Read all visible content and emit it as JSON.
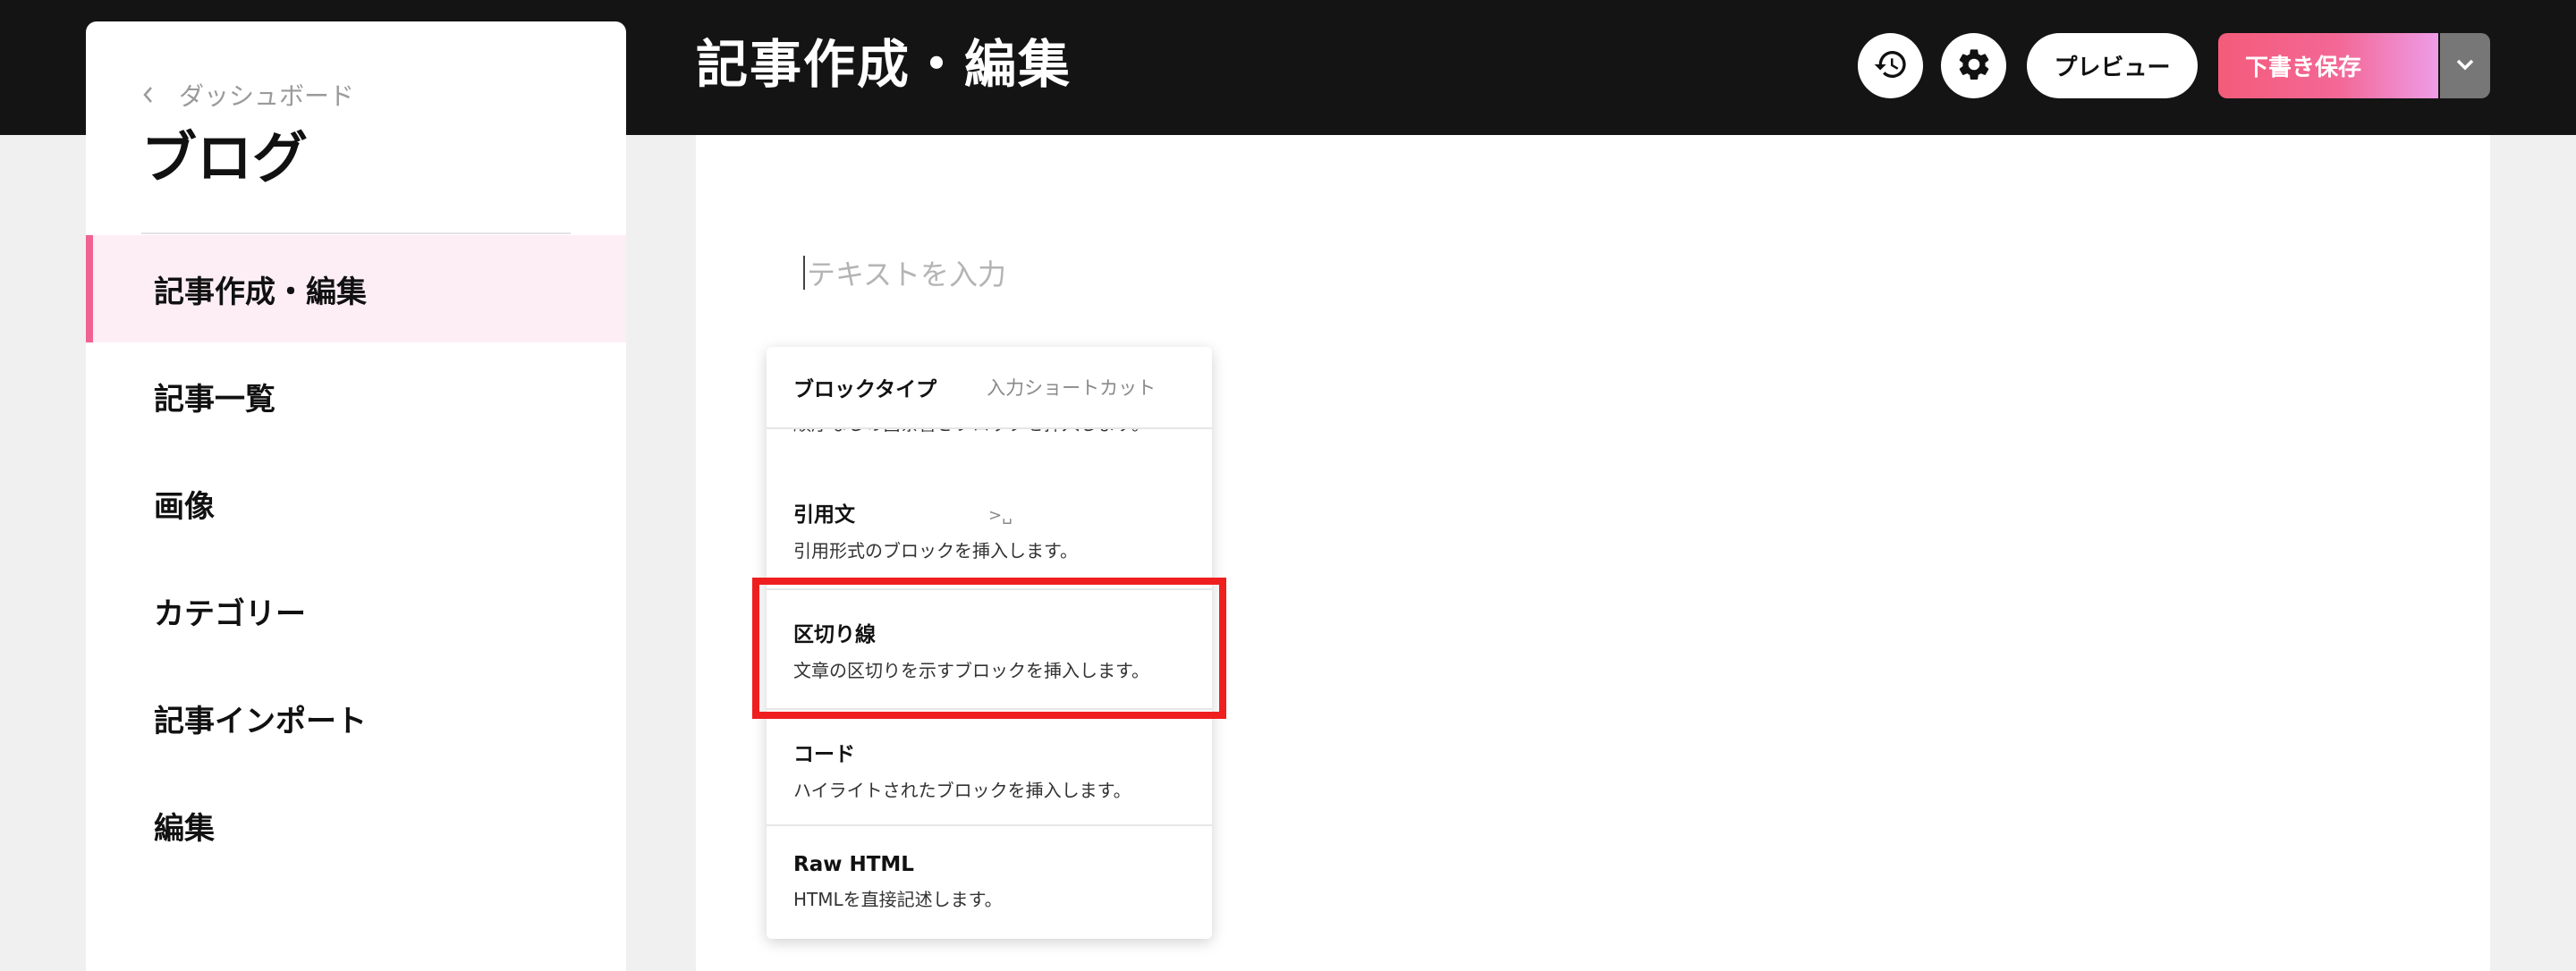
{
  "header": {
    "title": "記事作成・編集",
    "preview_label": "プレビュー",
    "save_label": "下書き保存"
  },
  "sidebar": {
    "back_label": "ダッシュボード",
    "title": "ブログ",
    "items": [
      {
        "label": "記事作成・編集",
        "active": true
      },
      {
        "label": "記事一覧"
      },
      {
        "label": "画像"
      },
      {
        "label": "カテゴリー"
      },
      {
        "label": "記事インポート"
      },
      {
        "label": "編集"
      }
    ]
  },
  "editor": {
    "placeholder": "テキストを入力"
  },
  "block_menu": {
    "header_type": "ブロックタイプ",
    "header_shortcut": "入力ショートカット",
    "clipped_text": "順序なしの箇条書きブロックを挿入します。",
    "items": [
      {
        "name": "引用文",
        "shortcut": ">␣",
        "desc": "引用形式のブロックを挿入します。"
      },
      {
        "name": "区切り線",
        "desc": "文章の区切りを示すブロックを挿入します。",
        "highlighted": true
      },
      {
        "name": "コード",
        "desc": "ハイライトされたブロックを挿入します。"
      },
      {
        "name": "Raw HTML",
        "desc": "HTMLを直接記述します。"
      }
    ]
  },
  "icons": {
    "history": "history-icon",
    "settings": "gear-icon",
    "dropdown": "chevron-down-icon",
    "back": "chevron-left-icon"
  },
  "colors": {
    "accent_pink": "#f06292",
    "highlight_red": "#f01f1f"
  }
}
